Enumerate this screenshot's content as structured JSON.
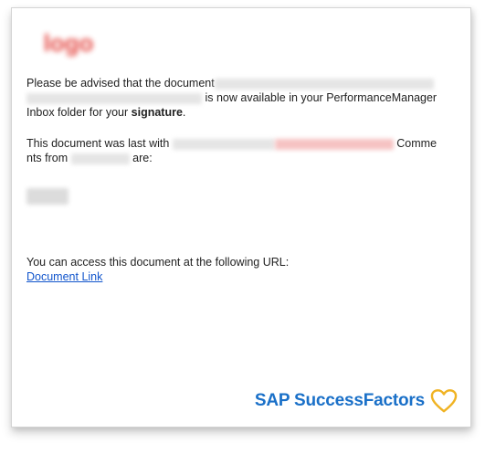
{
  "logo": "logo",
  "para1": {
    "before": "Please be advised that the document",
    "middle": "is now available in your PerformanceManager",
    "line3_a": "Inbox folder for your ",
    "line3_bold": "signature",
    "line3_end": "."
  },
  "para2": {
    "start": "This document was last with",
    "comments1": "Comme",
    "comments2": "nts from",
    "are": "are:"
  },
  "access": {
    "text": "You can access this document at the following URL:",
    "link_label": "Document Link"
  },
  "brand": {
    "name": "SAP SuccessFactors",
    "color": "#1a70c8",
    "heart_color": "#f0b323"
  }
}
